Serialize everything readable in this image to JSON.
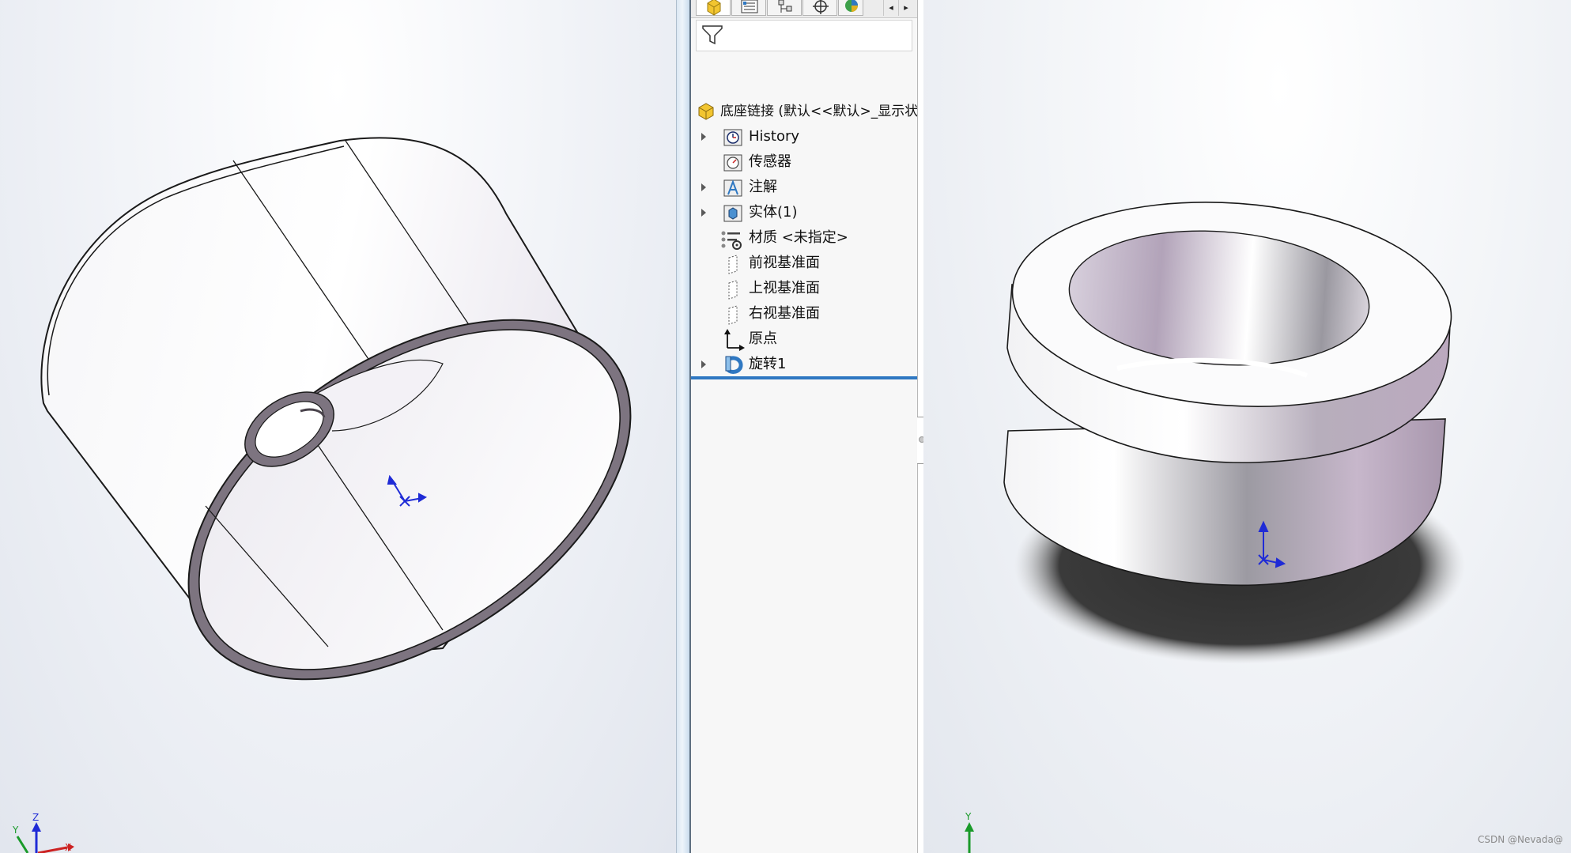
{
  "left_viewport": {
    "model": "oval-shell-part",
    "triad_axes": [
      "Y",
      "Z",
      "X"
    ]
  },
  "right_viewport": {
    "model": "flanged-bushing-part",
    "triad_axes": [
      "Y"
    ]
  },
  "feature_manager": {
    "tabs": [
      {
        "icon": "featuremanager-tab-icon",
        "active": true
      },
      {
        "icon": "propertymanager-tab-icon",
        "active": false
      },
      {
        "icon": "configurationmanager-tab-icon",
        "active": false
      },
      {
        "icon": "dimxpert-tab-icon",
        "active": false
      },
      {
        "icon": "display-manager-tab-icon",
        "active": false
      }
    ],
    "tab_scroll_left": "◂",
    "tab_scroll_right": "▸",
    "filter_icon": "filter-icon",
    "root_label": "底座链接 (默认<<默认>_显示状",
    "items": [
      {
        "label": "History",
        "icon": "history-icon",
        "expandable": true
      },
      {
        "label": "传感器",
        "icon": "sensors-icon",
        "expandable": false
      },
      {
        "label": "注解",
        "icon": "annotations-icon",
        "expandable": true
      },
      {
        "label": "实体(1)",
        "icon": "solid-bodies-icon",
        "expandable": true
      },
      {
        "label": "材质 <未指定>",
        "icon": "material-icon",
        "expandable": false
      },
      {
        "label": "前视基准面",
        "icon": "plane-icon",
        "expandable": false
      },
      {
        "label": "上视基准面",
        "icon": "plane-icon",
        "expandable": false
      },
      {
        "label": "右视基准面",
        "icon": "plane-icon",
        "expandable": false
      },
      {
        "label": "原点",
        "icon": "origin-icon",
        "expandable": false
      },
      {
        "label": "旋转1",
        "icon": "revolve-icon",
        "expandable": true
      }
    ]
  },
  "colors": {
    "tree_end_bar": "#2f78c2",
    "model_edge": "#1a1a1a",
    "shell_rim": "#7d7480",
    "triad_blue": "#1f2bd6",
    "triad_green": "#1a9a2a",
    "triad_red": "#cc2222"
  },
  "watermark": "CSDN @Nevada@"
}
